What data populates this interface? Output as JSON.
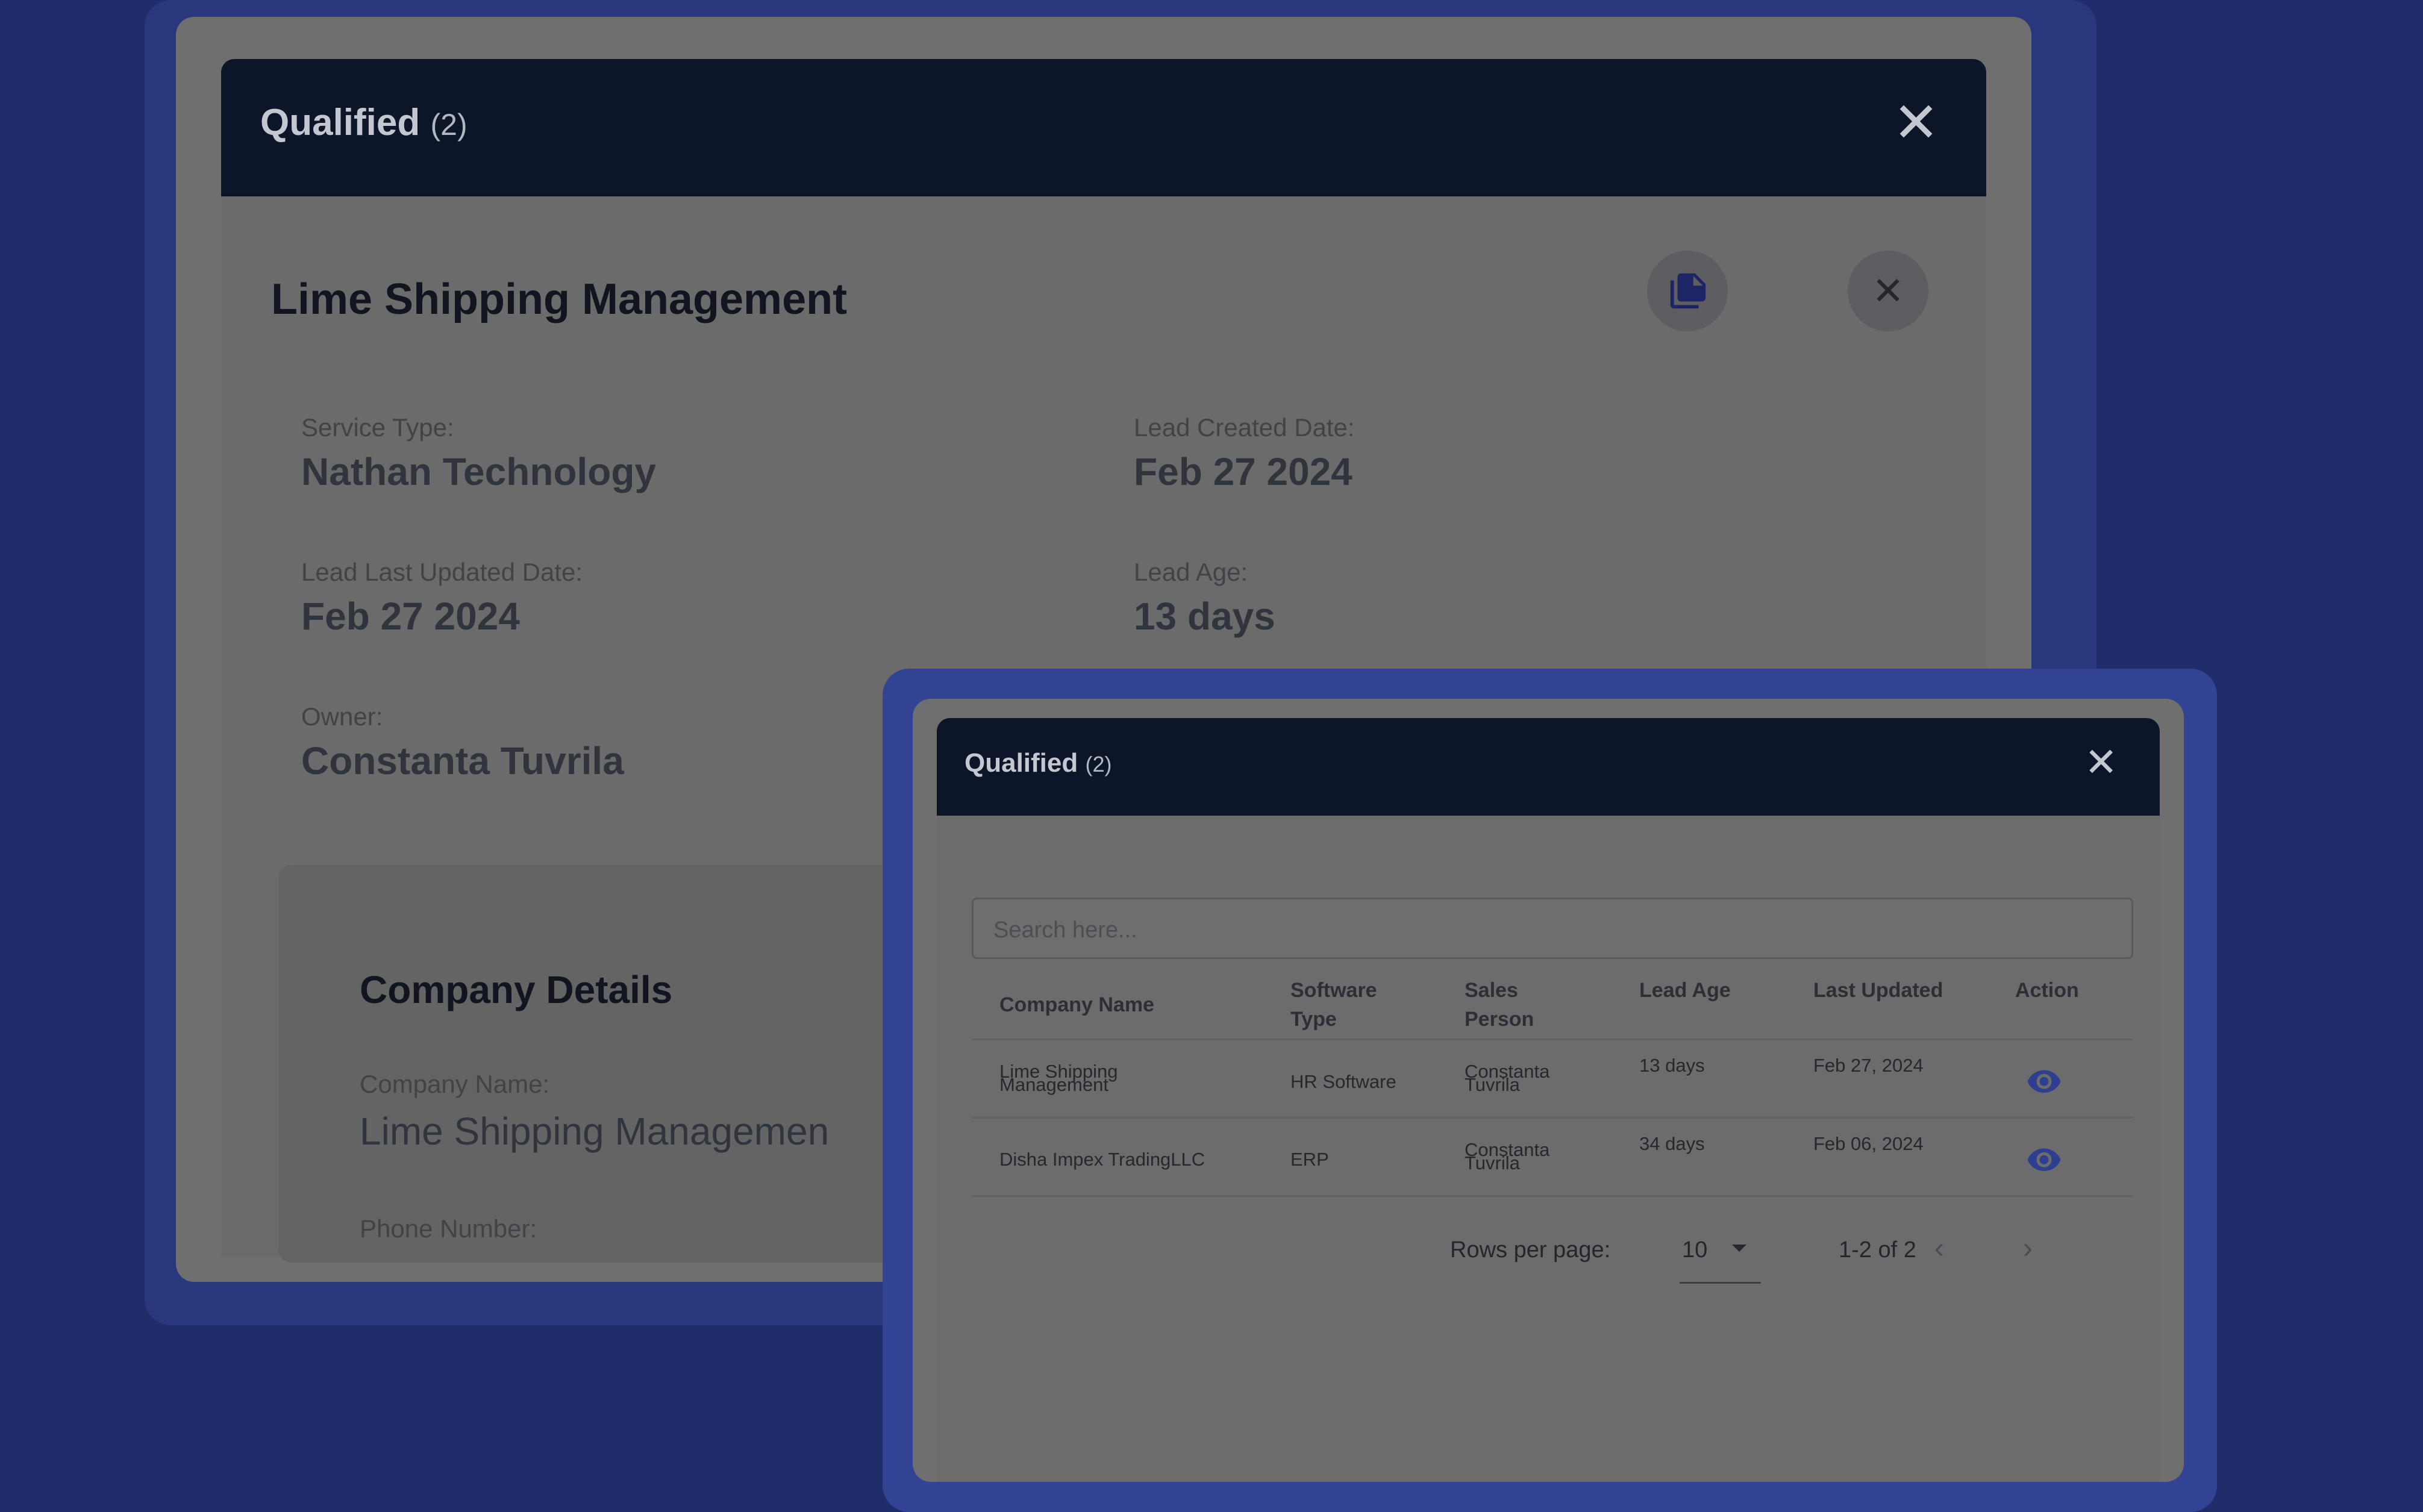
{
  "back_modal": {
    "title": "Qualified",
    "count": "(2)",
    "close_glyph": "✕",
    "entity_name": "Lime Shipping Management",
    "document_icon": "document-icon",
    "close_icon": "close-icon",
    "fields": {
      "service_type_label": "Service Type:",
      "service_type_value": "Nathan Technology",
      "lead_created_label": "Lead Created Date:",
      "lead_created_value": "Feb 27 2024",
      "lead_updated_label": "Lead Last Updated Date:",
      "lead_updated_value": "Feb 27 2024",
      "lead_age_label": "Lead Age:",
      "lead_age_value": "13 days",
      "owner_label": "Owner:",
      "owner_value": "Constanta Tuvrila"
    },
    "company_details": {
      "title": "Company Details",
      "company_name_label": "Company Name:",
      "company_name_value": "Lime Shipping Managemen",
      "phone_label": "Phone Number:"
    }
  },
  "front_modal": {
    "title": "Qualified",
    "count": "(2)",
    "close_glyph": "✕",
    "search": {
      "placeholder": "Search here..."
    },
    "table": {
      "headers": {
        "company_name": "Company Name",
        "software_type_1": "Software",
        "software_type_2": "Type",
        "sales_person_1": "Sales",
        "sales_person_2": "Person",
        "lead_age": "Lead Age",
        "last_updated": "Last Updated",
        "action": "Action"
      },
      "rows": [
        {
          "company_1": "Lime Shipping",
          "company_2": "Management",
          "software": "HR Software",
          "sales_1": "Constanta",
          "sales_2": "Tuvrila",
          "lead_age": "13 days",
          "last_updated": "Feb 27, 2024",
          "action_icon": "eye-icon"
        },
        {
          "company_1": "Disha Impex TradingLLC",
          "company_2": "",
          "software": "ERP",
          "sales_1": "Constanta",
          "sales_2": "Tuvrila",
          "lead_age": "34 days",
          "last_updated": "Feb 06, 2024",
          "action_icon": "eye-icon"
        }
      ]
    },
    "pagination": {
      "rows_per_page_label": "Rows per page:",
      "rows_per_page_value": "10",
      "range": "1-2 of 2",
      "prev_glyph": "‹",
      "next_glyph": "›"
    }
  },
  "colors": {
    "background": "#1f2d6a",
    "header_bar": "#0c1628",
    "eye_icon": "#2e3f8f",
    "document_icon": "#1e2566"
  }
}
